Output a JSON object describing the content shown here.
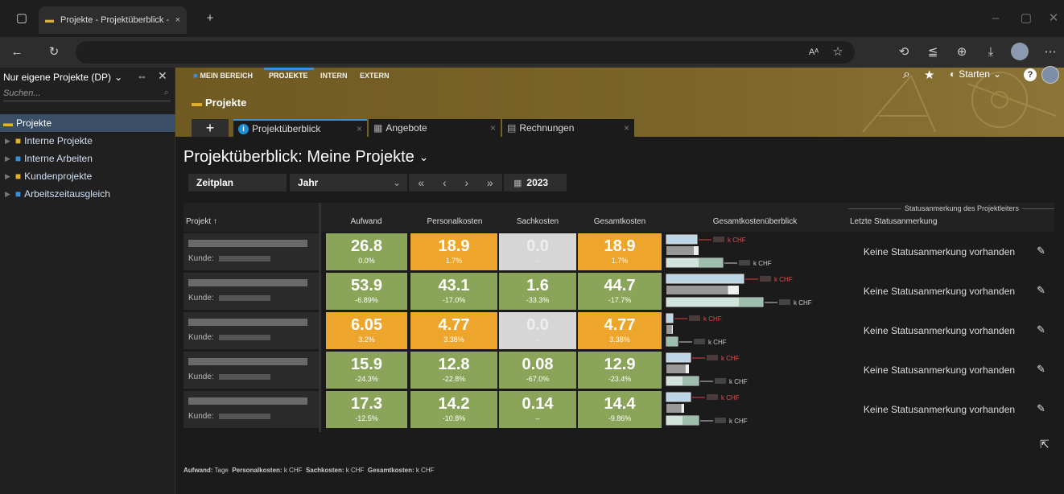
{
  "browser": {
    "tab_title": "Projekte - Projektüberblick - BCS",
    "new_tab": "+",
    "close": "×"
  },
  "sidebar": {
    "filter_label": "Nur eigene Projekte (DP)",
    "search_placeholder": "Suchen...",
    "selected": "Projekte",
    "items": [
      {
        "label": "Interne Projekte"
      },
      {
        "label": "Interne Arbeiten"
      },
      {
        "label": "Kundenprojekte"
      },
      {
        "label": "Arbeitszeitausgleich"
      }
    ]
  },
  "topnav": {
    "items": [
      "MEIN BEREICH",
      "PROJEKTE",
      "INTERN",
      "EXTERN"
    ],
    "active": "PROJEKTE",
    "starten": "Starten"
  },
  "page": {
    "module_title": "Projekte",
    "add": "+",
    "tabs": [
      "Projektüberblick",
      "Angebote",
      "Rechnungen"
    ],
    "tab_close": "×",
    "title": "Projektüberblick: Meine Projekte",
    "view_select": "Zeitplan",
    "period_select": "Jahr",
    "nav_first": "«",
    "nav_prev": "‹",
    "nav_next": "›",
    "nav_last": "»",
    "year": "2023"
  },
  "table": {
    "group_header": "Statusanmerkung des Projektleiters",
    "columns": [
      "Projekt ↑",
      "Aufwand",
      "Personalkosten",
      "Sachkosten",
      "Gesamtkosten",
      "Gesamtkostenüberblick",
      "Letzte Statusanmerkung"
    ],
    "kunde_label": "Kunde:",
    "unit": "k CHF",
    "rows": [
      {
        "aufwand": "26.8",
        "aufwand_pct": "0.0%",
        "personal": "18.9",
        "personal_pct": "1.7%",
        "sach": "0.0",
        "sach_pct": "–",
        "gesamt": "18.9",
        "gesamt_pct": "1.7%",
        "status": "Keine Statusanmerkung vorhanden",
        "colors": [
          "green",
          "orange",
          "grey",
          "orange"
        ]
      },
      {
        "aufwand": "53.9",
        "aufwand_pct": "-6.89%",
        "personal": "43.1",
        "personal_pct": "-17.0%",
        "sach": "1.6",
        "sach_pct": "-33.3%",
        "gesamt": "44.7",
        "gesamt_pct": "-17.7%",
        "status": "Keine Statusanmerkung vorhanden",
        "colors": [
          "green",
          "green",
          "green",
          "green"
        ]
      },
      {
        "aufwand": "6.05",
        "aufwand_pct": "3.2%",
        "personal": "4.77",
        "personal_pct": "3.38%",
        "sach": "0.0",
        "sach_pct": "–",
        "gesamt": "4.77",
        "gesamt_pct": "3.38%",
        "status": "Keine Statusanmerkung vorhanden",
        "colors": [
          "orange",
          "orange",
          "grey",
          "orange"
        ]
      },
      {
        "aufwand": "15.9",
        "aufwand_pct": "-24.3%",
        "personal": "12.8",
        "personal_pct": "-22.8%",
        "sach": "0.08",
        "sach_pct": "-67.0%",
        "gesamt": "12.9",
        "gesamt_pct": "-23.4%",
        "status": "Keine Statusanmerkung vorhanden",
        "colors": [
          "green",
          "green",
          "green",
          "green"
        ]
      },
      {
        "aufwand": "17.3",
        "aufwand_pct": "-12.5%",
        "personal": "14.2",
        "personal_pct": "-10.8%",
        "sach": "0.14",
        "sach_pct": "–",
        "gesamt": "14.4",
        "gesamt_pct": "-9.86%",
        "status": "Keine Statusanmerkung vorhanden",
        "colors": [
          "green",
          "green",
          "green",
          "green"
        ]
      }
    ]
  },
  "footer": {
    "aufwand_label": "Aufwand:",
    "aufwand_unit": "Tage",
    "personal_label": "Personalkosten:",
    "personal_unit": "k CHF",
    "sach_label": "Sachkosten:",
    "sach_unit": "k CHF",
    "gesamt_label": "Gesamtkosten:",
    "gesamt_unit": "k CHF"
  },
  "colors": {
    "green": "#8aa55a",
    "orange": "#eea52c",
    "grey": "#d6d6d6",
    "header": "#7b652a",
    "accent_blue": "#1e8fd6"
  }
}
